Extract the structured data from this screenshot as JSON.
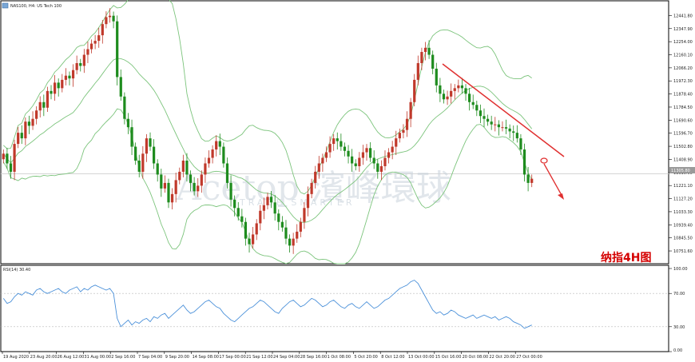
{
  "window": {
    "title": "NAS100, H4: US Tech 100",
    "annotation": "纳指4H图",
    "watermark": "Acetop 濱峰環球",
    "watermark_sub": "TRADE SMARTER",
    "rsi_label": "RSI(14) 30.40",
    "current_price_tag": "11305.80"
  },
  "colors": {
    "bull": "#c0392b",
    "bear": "#1e8c1e",
    "band": "#7cc47c",
    "rsi": "#4a90d9",
    "trend": "#e03030",
    "grid": "#cfcfcf"
  },
  "chart_data": [
    {
      "type": "line",
      "title": "NAS100, H4: US Tech 100",
      "xlabel": "",
      "ylabel": "",
      "ylim": [
        10660,
        12490
      ],
      "y_ticks": [
        "12441.80",
        "12347.90",
        "12254.00",
        "12160.10",
        "12066.20",
        "11972.30",
        "11878.40",
        "11784.50",
        "11690.60",
        "11596.70",
        "11502.80",
        "11408.90",
        "11315.00",
        "11221.10",
        "11127.20",
        "11033.30",
        "10939.40",
        "10845.50",
        "10751.60"
      ],
      "x_ticks": [
        "19 Aug 2020",
        "23 Aug 20:00",
        "26 Aug 12:00",
        "31 Aug 00:00",
        "2 Sep 16:00",
        "7 Sep 04:00",
        "9 Sep 20:00",
        "14 Sep 08:00",
        "17 Sep 00:00",
        "21 Sep 12:00",
        "24 Sep 04:00",
        "28 Sep 16:00",
        "1 Oct 08:00",
        "5 Oct 20:00",
        "8 Oct 12:00",
        "13 Oct 00:00",
        "15 Oct 16:00",
        "20 Oct 08:00",
        "22 Oct 20:00",
        "27 Oct 00:00"
      ],
      "series": [
        {
          "name": "",
          "values": [
            11450,
            11380,
            11320,
            11520,
            11600,
            11560,
            11680,
            11650,
            11700,
            11760,
            11820,
            11780,
            11900,
            11880,
            11960,
            11920,
            11980,
            12010,
            11990,
            12050,
            12100,
            12080,
            12160,
            12200,
            12240,
            12260,
            12300,
            12380,
            12430,
            12440,
            12400,
            12000,
            11860,
            11700,
            11640,
            11500,
            11400,
            11320,
            11450,
            11560,
            11500,
            11380,
            11300,
            11200,
            11240,
            11100,
            11160,
            11260,
            11320,
            11400,
            11300,
            11240,
            11180,
            11220,
            11300,
            11380,
            11420,
            11480,
            11540,
            11500,
            11380,
            11240,
            11120,
            11060,
            11000,
            10960,
            10840,
            10800,
            10870,
            10950,
            11040,
            11080,
            11140,
            11100,
            11020,
            10960,
            10920,
            10840,
            10790,
            10840,
            10890,
            10960,
            11060,
            11160,
            11240,
            11320,
            11380,
            11420,
            11460,
            11520,
            11560,
            11540,
            11500,
            11470,
            11430,
            11380,
            11360,
            11420,
            11460,
            11490,
            11420,
            11380,
            11320,
            11360,
            11420,
            11460,
            11500,
            11560,
            11600,
            11620,
            11700,
            11820,
            11980,
            12100,
            12180,
            12210,
            12160,
            12060,
            11940,
            11880,
            11840,
            11860,
            11900,
            11920,
            11940,
            11920,
            11880,
            11820,
            11800,
            11760,
            11720,
            11700,
            11680,
            11660,
            11660,
            11640,
            11640,
            11630,
            11610,
            11600,
            11560,
            11480,
            11300,
            11240,
            11270
          ]
        }
      ]
    },
    {
      "type": "line",
      "title": "RSI(14) 30.40",
      "xlabel": "",
      "ylabel": "",
      "ylim": [
        0,
        100
      ],
      "y_ticks": [
        "100.00",
        "70.00",
        "30.00",
        "0.00"
      ],
      "levels": [
        70,
        30
      ],
      "series": [
        {
          "name": "",
          "values": [
            64,
            58,
            60,
            66,
            70,
            68,
            72,
            70,
            68,
            74,
            76,
            72,
            70,
            72,
            74,
            76,
            72,
            70,
            74,
            76,
            78,
            72,
            76,
            74,
            78,
            80,
            78,
            76,
            74,
            76,
            70,
            40,
            30,
            34,
            38,
            32,
            36,
            34,
            38,
            40,
            36,
            42,
            40,
            44,
            46,
            40,
            44,
            48,
            52,
            56,
            50,
            46,
            48,
            52,
            56,
            60,
            62,
            58,
            54,
            52,
            46,
            42,
            38,
            36,
            40,
            44,
            48,
            52,
            54,
            58,
            62,
            60,
            56,
            52,
            48,
            46,
            52,
            56,
            60,
            62,
            58,
            54,
            56,
            60,
            64,
            62,
            58,
            54,
            56,
            60,
            62,
            58,
            54,
            52,
            56,
            58,
            54,
            52,
            56,
            60,
            56,
            52,
            54,
            58,
            62,
            64,
            68,
            72,
            76,
            78,
            80,
            84,
            86,
            82,
            74,
            66,
            58,
            50,
            46,
            48,
            44,
            46,
            50,
            48,
            44,
            42,
            40,
            42,
            44,
            40,
            42,
            44,
            42,
            40,
            42,
            38,
            40,
            42,
            40,
            36,
            34,
            32,
            28,
            30,
            32
          ]
        }
      ]
    }
  ]
}
